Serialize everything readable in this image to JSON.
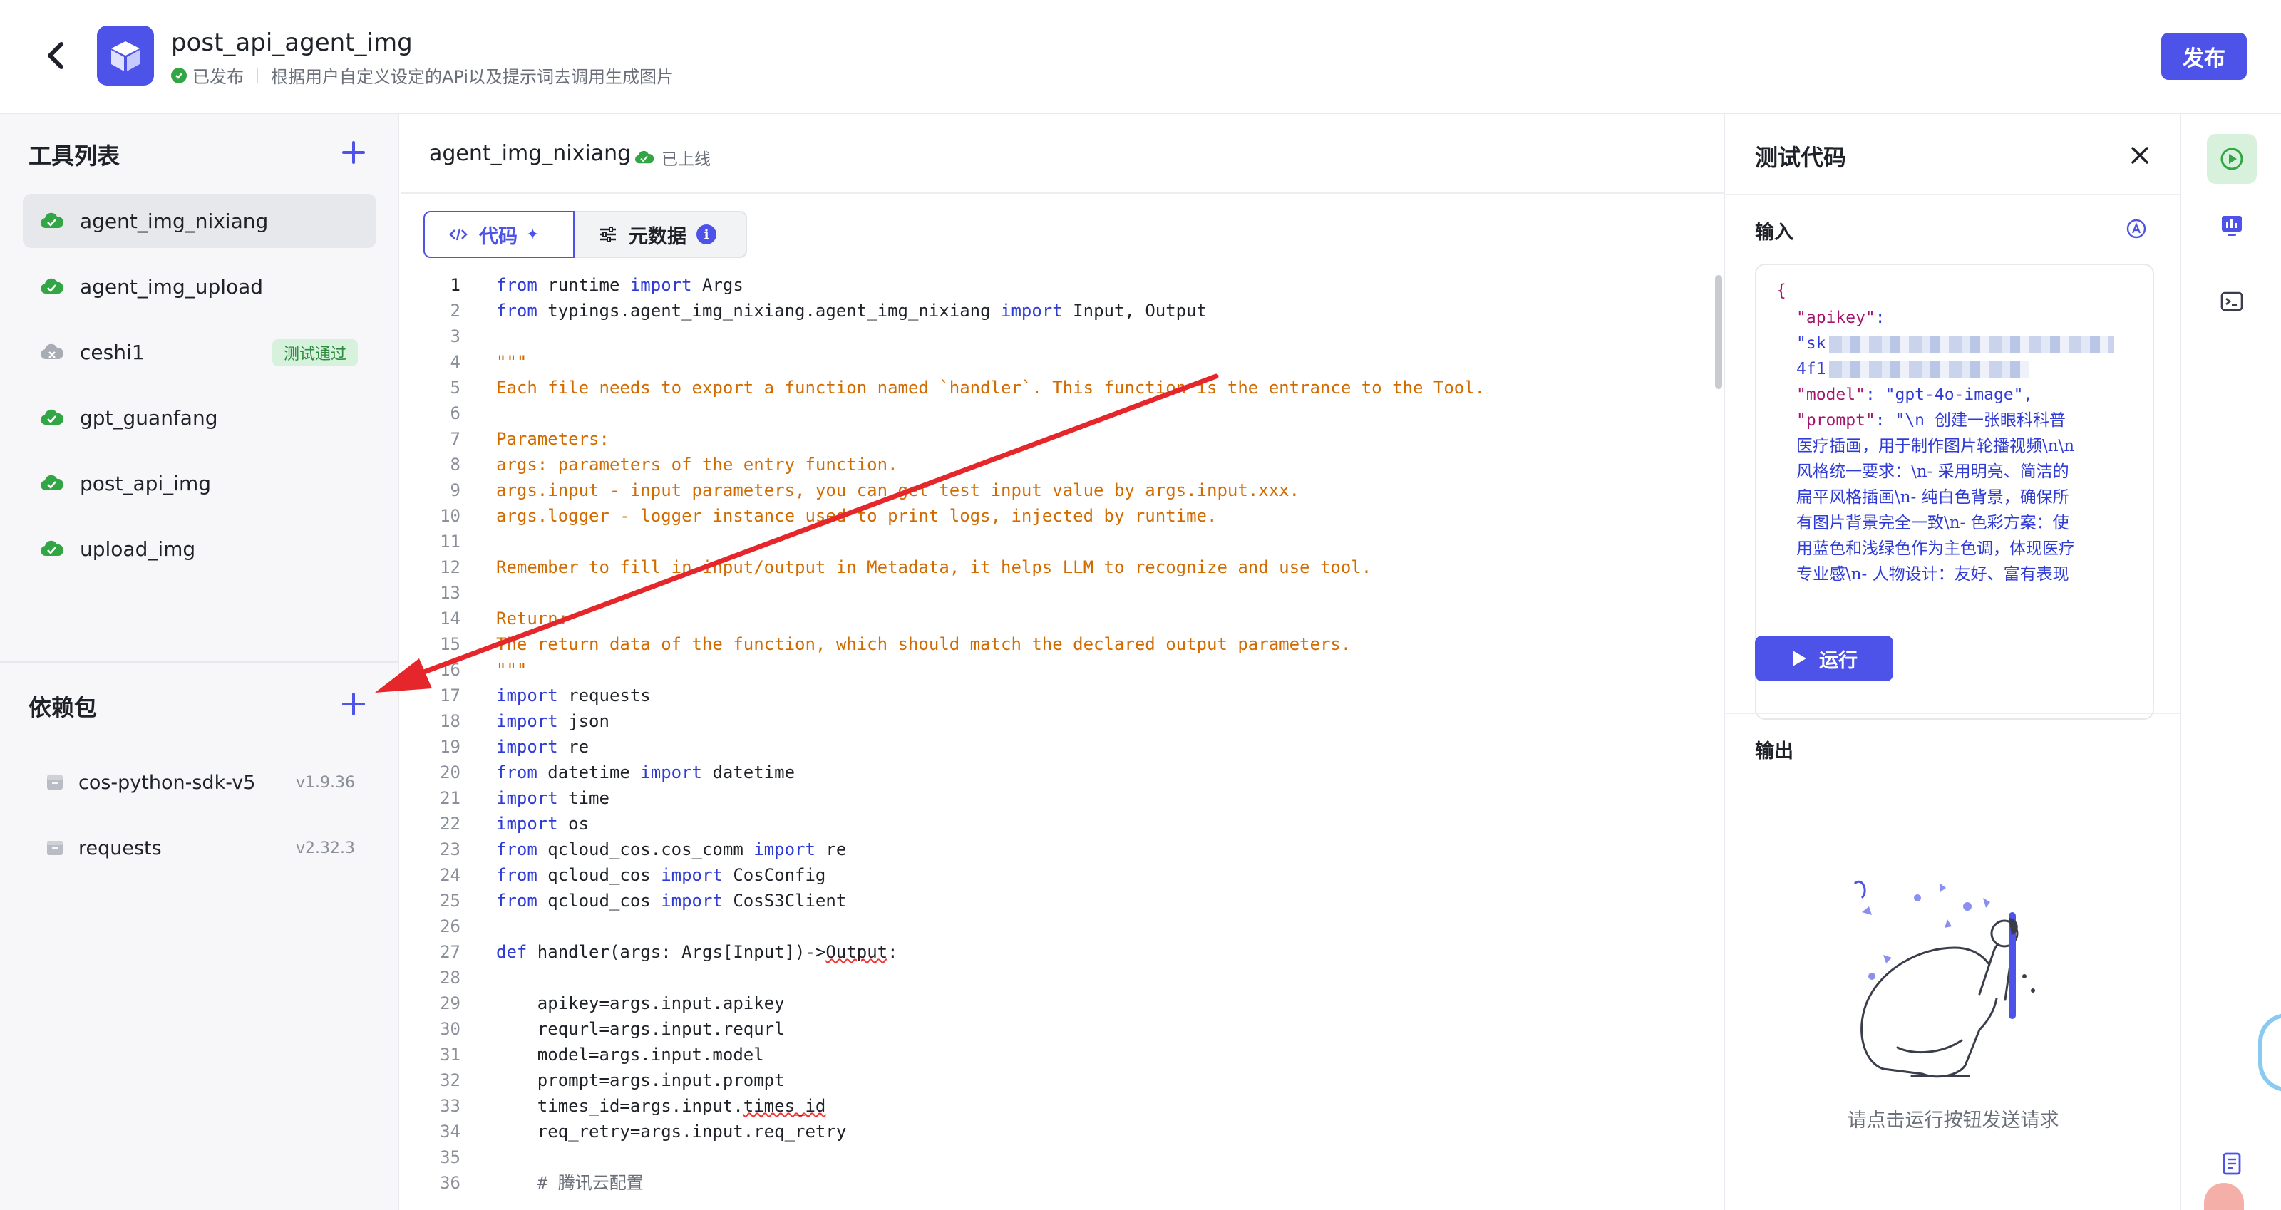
{
  "header": {
    "title": "post_api_agent_img",
    "status": "已发布",
    "description": "根据用户自定义设定的APi以及提示词去调用生成图片",
    "publish_label": "发布"
  },
  "sidebar": {
    "tools_heading": "工具列表",
    "tools": [
      {
        "name": "agent_img_nixiang",
        "active": true,
        "status": "online"
      },
      {
        "name": "agent_img_upload",
        "status": "online"
      },
      {
        "name": "ceshi1",
        "status": "offline",
        "badge": "测试通过"
      },
      {
        "name": "gpt_guanfang",
        "status": "online"
      },
      {
        "name": "post_api_img",
        "status": "online"
      },
      {
        "name": "upload_img",
        "status": "online"
      }
    ],
    "deps_heading": "依赖包",
    "deps": [
      {
        "name": "cos-python-sdk-v5",
        "version": "v1.9.36"
      },
      {
        "name": "requests",
        "version": "v2.32.3"
      }
    ]
  },
  "editor": {
    "tool_name": "agent_img_nixiang",
    "tool_status": "已上线",
    "tab_code": "代码",
    "tab_meta": "元数据",
    "info_glyph": "i",
    "sparkle_glyph": "✦"
  },
  "code_lines": [
    {
      "n": "1",
      "parts": [
        [
          "kw",
          "from"
        ],
        [
          "t",
          " runtime "
        ],
        [
          "kw",
          "import"
        ],
        [
          "t",
          " Args"
        ]
      ]
    },
    {
      "n": "2",
      "parts": [
        [
          "kw",
          "from"
        ],
        [
          "t",
          " typings.agent_img_nixiang.agent_img_nixiang "
        ],
        [
          "kw",
          "import"
        ],
        [
          "t",
          " Input, Output"
        ]
      ]
    },
    {
      "n": "3",
      "parts": []
    },
    {
      "n": "4",
      "parts": [
        [
          "doc",
          "\"\"\""
        ]
      ]
    },
    {
      "n": "5",
      "parts": [
        [
          "doc",
          "Each file needs to export a function named `handler`. This function is the entrance to the Tool."
        ]
      ]
    },
    {
      "n": "6",
      "parts": []
    },
    {
      "n": "7",
      "parts": [
        [
          "doc",
          "Parameters:"
        ]
      ]
    },
    {
      "n": "8",
      "parts": [
        [
          "doc",
          "args: parameters of the entry function."
        ]
      ]
    },
    {
      "n": "9",
      "parts": [
        [
          "doc",
          "args.input - input parameters, you can get test input value by args.input.xxx."
        ]
      ]
    },
    {
      "n": "10",
      "parts": [
        [
          "doc",
          "args.logger - logger instance used to print logs, injected by runtime."
        ]
      ]
    },
    {
      "n": "11",
      "parts": []
    },
    {
      "n": "12",
      "parts": [
        [
          "doc",
          "Remember to fill in input/output in Metadata, it helps LLM to recognize and use tool."
        ]
      ]
    },
    {
      "n": "13",
      "parts": []
    },
    {
      "n": "14",
      "parts": [
        [
          "doc",
          "Return:"
        ]
      ]
    },
    {
      "n": "15",
      "parts": [
        [
          "doc",
          "The return data of the function, which should match the declared output parameters."
        ]
      ]
    },
    {
      "n": "16",
      "parts": [
        [
          "doc",
          "\"\"\""
        ]
      ]
    },
    {
      "n": "17",
      "parts": [
        [
          "kw",
          "import"
        ],
        [
          "t",
          " requests"
        ]
      ]
    },
    {
      "n": "18",
      "parts": [
        [
          "kw",
          "import"
        ],
        [
          "t",
          " json"
        ]
      ]
    },
    {
      "n": "19",
      "parts": [
        [
          "kw",
          "import"
        ],
        [
          "t",
          " re"
        ]
      ]
    },
    {
      "n": "20",
      "parts": [
        [
          "kw",
          "from"
        ],
        [
          "t",
          " datetime "
        ],
        [
          "kw",
          "import"
        ],
        [
          "t",
          " datetime"
        ]
      ]
    },
    {
      "n": "21",
      "parts": [
        [
          "kw",
          "import"
        ],
        [
          "t",
          " time"
        ]
      ]
    },
    {
      "n": "22",
      "parts": [
        [
          "kw",
          "import"
        ],
        [
          "t",
          " os"
        ]
      ]
    },
    {
      "n": "23",
      "parts": [
        [
          "kw",
          "from"
        ],
        [
          "t",
          " qcloud_cos.cos_comm "
        ],
        [
          "kw",
          "import"
        ],
        [
          "t",
          " re"
        ]
      ]
    },
    {
      "n": "24",
      "parts": [
        [
          "kw",
          "from"
        ],
        [
          "t",
          " qcloud_cos "
        ],
        [
          "kw",
          "import"
        ],
        [
          "t",
          " CosConfig"
        ]
      ]
    },
    {
      "n": "25",
      "parts": [
        [
          "kw",
          "from"
        ],
        [
          "t",
          " qcloud_cos "
        ],
        [
          "kw",
          "import"
        ],
        [
          "t",
          " CosS3Client"
        ]
      ]
    },
    {
      "n": "26",
      "parts": []
    },
    {
      "n": "27",
      "parts": [
        [
          "kw",
          "def"
        ],
        [
          "t",
          " handler(args: Args[Input])->"
        ],
        [
          "sq",
          "Output"
        ],
        [
          "t",
          ":"
        ]
      ]
    },
    {
      "n": "28",
      "parts": []
    },
    {
      "n": "29",
      "parts": [
        [
          "t",
          "    apikey=args.input.apikey"
        ]
      ]
    },
    {
      "n": "30",
      "parts": [
        [
          "t",
          "    requrl=args.input.requrl"
        ]
      ]
    },
    {
      "n": "31",
      "parts": [
        [
          "t",
          "    model=args.input.model"
        ]
      ]
    },
    {
      "n": "32",
      "parts": [
        [
          "t",
          "    prompt=args.input.prompt"
        ]
      ]
    },
    {
      "n": "33",
      "parts": [
        [
          "t",
          "    times_id=args.input."
        ],
        [
          "sq",
          "times_id"
        ]
      ]
    },
    {
      "n": "34",
      "parts": [
        [
          "t",
          "    req_retry=args.input.req_retry"
        ]
      ]
    },
    {
      "n": "35",
      "parts": []
    },
    {
      "n": "36",
      "parts": [
        [
          "cm",
          "    # 腾讯云配置"
        ]
      ]
    }
  ],
  "test_panel": {
    "title": "测试代码",
    "input_label": "输入",
    "json_lines": [
      {
        "kind": "brace",
        "text": "{"
      },
      {
        "kind": "kv",
        "key": "\"apikey\"",
        "value": ":"
      },
      {
        "kind": "str",
        "text": "\"sk"
      },
      {
        "kind": "str",
        "text": "4f1"
      },
      {
        "kind": "kv",
        "key": "\"model\"",
        "value": ": \"gpt-4o-image\","
      },
      {
        "kind": "kv",
        "key": "\"prompt\"",
        "value": ": \"\\n    创建一张眼科科普"
      },
      {
        "kind": "cn",
        "text": "医疗插画，用于制作图片轮播视频\\n\\n"
      },
      {
        "kind": "cn",
        "text": "风格统一要求：\\n- 采用明亮、简洁的"
      },
      {
        "kind": "cn",
        "text": "扁平风格插画\\n- 纯白色背景，确保所"
      },
      {
        "kind": "cn",
        "text": "有图片背景完全一致\\n- 色彩方案：使"
      },
      {
        "kind": "cn",
        "text": "用蓝色和浅绿色作为主色调，体现医疗"
      },
      {
        "kind": "cn",
        "text": "专业感\\n- 人物设计：友好、富有表现"
      }
    ],
    "run_label": "运行",
    "output_label": "输出",
    "empty_text": "请点击运行按钮发送请求"
  },
  "colors": {
    "accent": "#4d53e8",
    "success": "#32a645",
    "annotation_arrow": "#e5262b",
    "docstring": "#d16b00",
    "keyword": "#2f3bd6"
  }
}
